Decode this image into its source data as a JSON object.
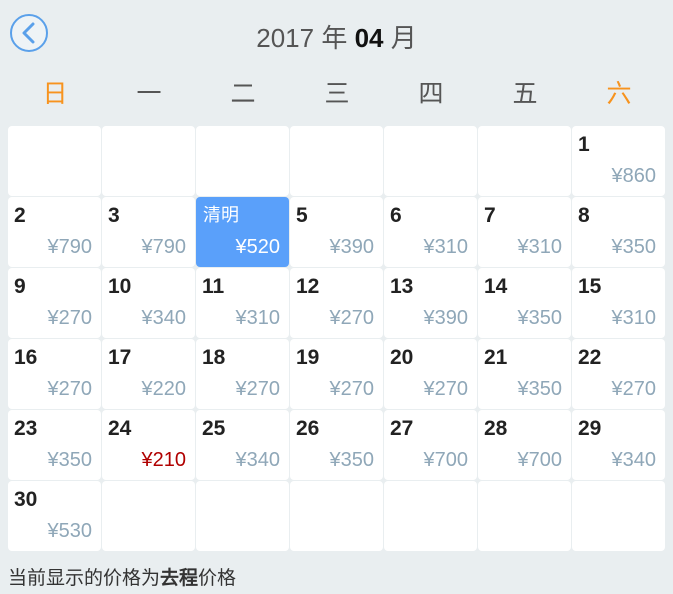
{
  "header": {
    "year_text": "2017 年 ",
    "month_bold": "04",
    "month_suffix": " 月"
  },
  "weekdays": [
    "日",
    "一",
    "二",
    "三",
    "四",
    "五",
    "六"
  ],
  "days": [
    {
      "day": "1",
      "price": "¥860"
    },
    {
      "day": "2",
      "price": "¥790"
    },
    {
      "day": "3",
      "price": "¥790"
    },
    {
      "holiday": "清明",
      "price": "¥520"
    },
    {
      "day": "5",
      "price": "¥390"
    },
    {
      "day": "6",
      "price": "¥310"
    },
    {
      "day": "7",
      "price": "¥310"
    },
    {
      "day": "8",
      "price": "¥350"
    },
    {
      "day": "9",
      "price": "¥270"
    },
    {
      "day": "10",
      "price": "¥340"
    },
    {
      "day": "11",
      "price": "¥310"
    },
    {
      "day": "12",
      "price": "¥270"
    },
    {
      "day": "13",
      "price": "¥390"
    },
    {
      "day": "14",
      "price": "¥350"
    },
    {
      "day": "15",
      "price": "¥310"
    },
    {
      "day": "16",
      "price": "¥270"
    },
    {
      "day": "17",
      "price": "¥220"
    },
    {
      "day": "18",
      "price": "¥270"
    },
    {
      "day": "19",
      "price": "¥270"
    },
    {
      "day": "20",
      "price": "¥270"
    },
    {
      "day": "21",
      "price": "¥350"
    },
    {
      "day": "22",
      "price": "¥270"
    },
    {
      "day": "23",
      "price": "¥350"
    },
    {
      "day": "24",
      "price": "¥210"
    },
    {
      "day": "25",
      "price": "¥340"
    },
    {
      "day": "26",
      "price": "¥350"
    },
    {
      "day": "27",
      "price": "¥700"
    },
    {
      "day": "28",
      "price": "¥700"
    },
    {
      "day": "29",
      "price": "¥340"
    },
    {
      "day": "30",
      "price": "¥530"
    }
  ],
  "footer": {
    "prefix": "当前显示的价格为",
    "bold": "去程",
    "suffix": "价格"
  },
  "colors": {
    "accent": "#5aa0fa",
    "weekend": "#f7931e",
    "price": "#8fa7b8",
    "lowest_price": "#b00000"
  }
}
